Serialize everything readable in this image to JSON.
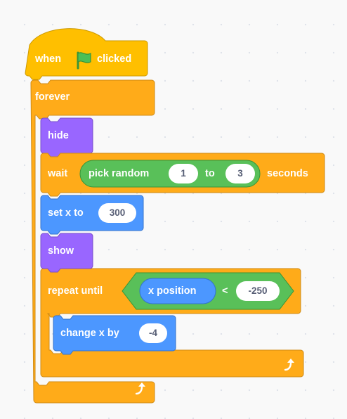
{
  "colors": {
    "events": "#FFBF00",
    "control": "#FFAB19",
    "control_dark": "#CF8B17",
    "looks": "#9966FF",
    "looks_dark": "#774DCB",
    "motion": "#4C97FF",
    "motion_dark": "#3373CC",
    "operators": "#59C059",
    "operators_dark": "#389438",
    "flag": "#4CBF56"
  },
  "script": {
    "hat": {
      "when_label": "when",
      "icon": "green-flag-icon",
      "clicked_label": "clicked"
    },
    "forever": {
      "label": "forever",
      "loop_icon": "loop-arrow-icon"
    },
    "hide": {
      "label": "hide"
    },
    "wait": {
      "label": "wait",
      "pick_random_label": "pick random",
      "from_value": "1",
      "to_label": "to",
      "to_value": "3",
      "seconds_label": "seconds"
    },
    "set_x": {
      "label": "set x to",
      "value": "300"
    },
    "show": {
      "label": "show"
    },
    "repeat_until": {
      "label": "repeat until",
      "x_position_label": "x position",
      "less_than": "<",
      "compare_value": "-250",
      "loop_icon": "loop-arrow-icon"
    },
    "change_x": {
      "label": "change x by",
      "value": "-4"
    }
  }
}
